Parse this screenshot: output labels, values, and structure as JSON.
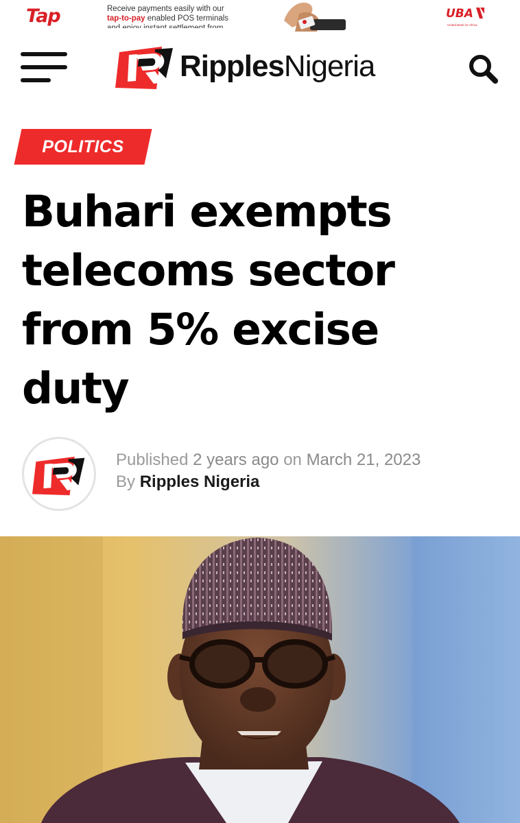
{
  "ad": {
    "brand": "Tap",
    "line1": "Receive payments easily with our",
    "highlight": "tap-to-pay",
    "line2_rest": " enabled POS terminals",
    "line3": "and enjoy instant settlement from",
    "bank_name": "UBA",
    "bank_tagline": "United Bank for Africa"
  },
  "header": {
    "logo_bold": "Ripples",
    "logo_light": "Nigeria"
  },
  "article": {
    "category": "POLITICS",
    "headline_lines": [
      "Buhari exempts",
      "telecoms sector",
      "from 5% excise",
      "duty"
    ],
    "published_label": "Published",
    "published_relative": "2 years ago",
    "on_label": "on",
    "published_date": "March 21, 2023",
    "by_label": "By",
    "author": "Ripples Nigeria"
  },
  "colors": {
    "brand_red": "#ee2b2b",
    "headline": "#000000",
    "meta_gray": "#9a9a9a"
  },
  "icons": {
    "menu": "hamburger-icon",
    "search": "search-icon",
    "logo": "ripples-r-logo",
    "avatar": "ripples-r-logo"
  }
}
